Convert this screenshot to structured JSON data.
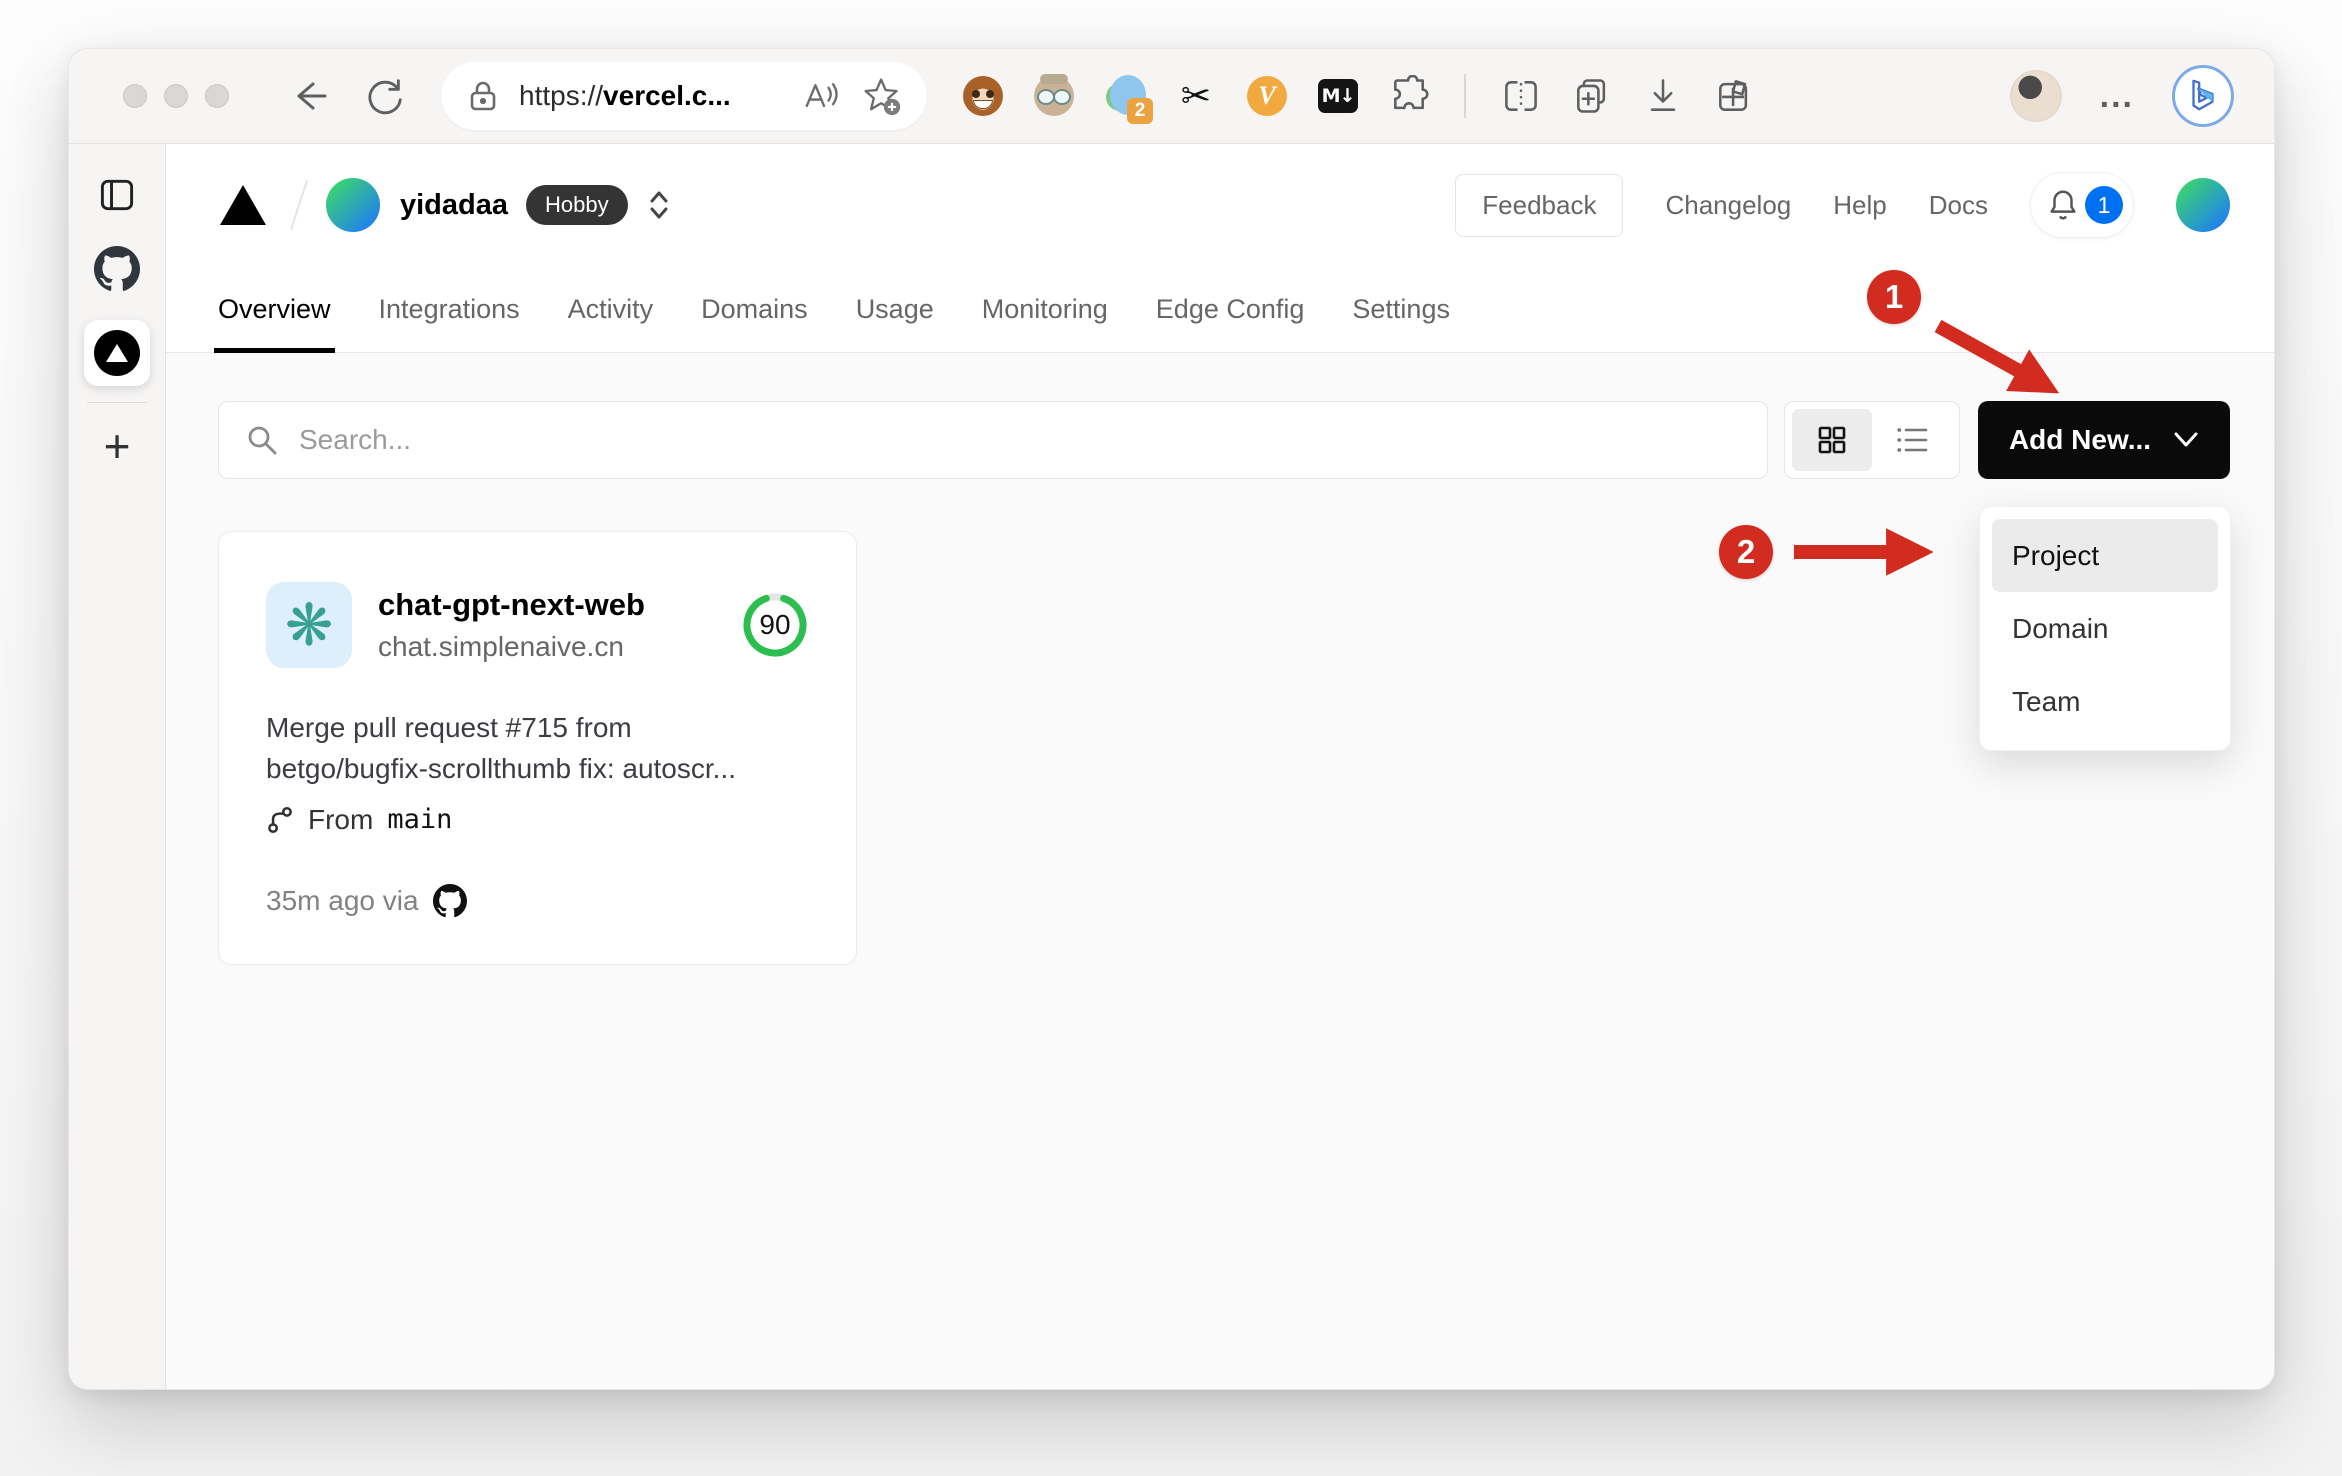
{
  "browser": {
    "url_scheme": "https://",
    "url_host": "vercel.c...",
    "menu_dots": "...",
    "extensions": {
      "badge": "2",
      "v_label": "V",
      "md_label": "M↓",
      "scissors": "✂"
    }
  },
  "sidebar": {
    "new_tab": "+"
  },
  "vercel": {
    "team": "yidadaa",
    "plan": "Hobby",
    "feedback": "Feedback",
    "links": {
      "changelog": "Changelog",
      "help": "Help",
      "docs": "Docs"
    },
    "notifications": "1"
  },
  "tabs": [
    {
      "label": "Overview"
    },
    {
      "label": "Integrations"
    },
    {
      "label": "Activity"
    },
    {
      "label": "Domains"
    },
    {
      "label": "Usage"
    },
    {
      "label": "Monitoring"
    },
    {
      "label": "Edge Config"
    },
    {
      "label": "Settings"
    }
  ],
  "toolbar": {
    "search_placeholder": "Search...",
    "add_new": "Add New..."
  },
  "dropdown": {
    "items": [
      "Project",
      "Domain",
      "Team"
    ]
  },
  "card": {
    "name": "chat-gpt-next-web",
    "domain": "chat.simplenaive.cn",
    "score": "90",
    "commit_line1": "Merge pull request #715 from",
    "commit_line2": "betgo/bugfix-scrollthumb fix: autoscr...",
    "from_label": "From",
    "branch": "main",
    "meta": "35m ago via"
  },
  "annotations": {
    "step1": "1",
    "step2": "2"
  },
  "colors": {
    "accent_red": "#d22b20",
    "score_green": "#2cbe4e",
    "notification_blue": "#0070f3",
    "add_new_bg": "#0a0a0a"
  }
}
